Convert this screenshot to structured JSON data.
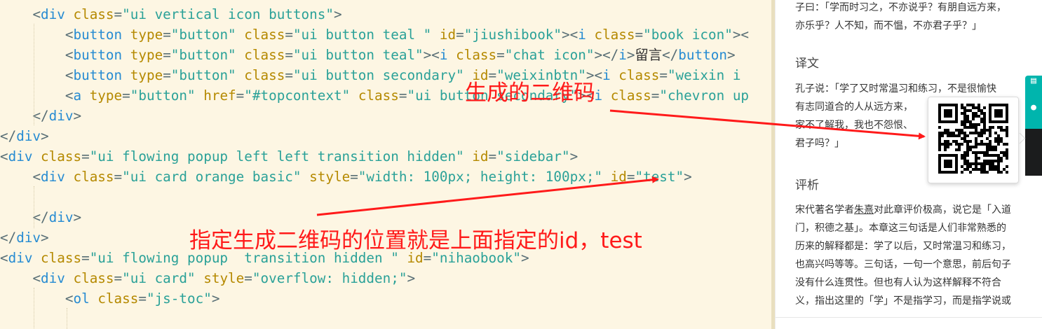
{
  "editor": {
    "lines": [
      {
        "indent": "    ",
        "tokens": [
          [
            "punc",
            "<"
          ],
          [
            "tag",
            "div"
          ],
          [
            "text",
            " "
          ],
          [
            "attr",
            "class"
          ],
          [
            "punc",
            "="
          ],
          [
            "val",
            "\"ui vertical icon buttons\""
          ],
          [
            "punc",
            ">"
          ]
        ]
      },
      {
        "indent": "        ",
        "tokens": [
          [
            "punc",
            "<"
          ],
          [
            "tag",
            "button"
          ],
          [
            "text",
            " "
          ],
          [
            "attr",
            "type"
          ],
          [
            "punc",
            "="
          ],
          [
            "val",
            "\"button\""
          ],
          [
            "text",
            " "
          ],
          [
            "attr",
            "class"
          ],
          [
            "punc",
            "="
          ],
          [
            "val",
            "\"ui button teal \""
          ],
          [
            "text",
            " "
          ],
          [
            "attr",
            "id"
          ],
          [
            "punc",
            "="
          ],
          [
            "val",
            "\"jiushibook\""
          ],
          [
            "punc",
            "><"
          ],
          [
            "tag",
            "i"
          ],
          [
            "text",
            " "
          ],
          [
            "attr",
            "class"
          ],
          [
            "punc",
            "="
          ],
          [
            "val",
            "\"book icon\""
          ],
          [
            "punc",
            "><"
          ]
        ]
      },
      {
        "indent": "        ",
        "tokens": [
          [
            "punc",
            "<"
          ],
          [
            "tag",
            "button"
          ],
          [
            "text",
            " "
          ],
          [
            "attr",
            "type"
          ],
          [
            "punc",
            "="
          ],
          [
            "val",
            "\"button\""
          ],
          [
            "text",
            " "
          ],
          [
            "attr",
            "class"
          ],
          [
            "punc",
            "="
          ],
          [
            "val",
            "\"ui button teal\""
          ],
          [
            "punc",
            "><"
          ],
          [
            "tag",
            "i"
          ],
          [
            "text",
            " "
          ],
          [
            "attr",
            "class"
          ],
          [
            "punc",
            "="
          ],
          [
            "val",
            "\"chat icon\""
          ],
          [
            "punc",
            "></"
          ],
          [
            "tag",
            "i"
          ],
          [
            "punc",
            ">"
          ],
          [
            "text",
            "留言"
          ],
          [
            "punc",
            "</"
          ],
          [
            "tag",
            "button"
          ],
          [
            "punc",
            ">"
          ]
        ]
      },
      {
        "indent": "        ",
        "tokens": [
          [
            "punc",
            "<"
          ],
          [
            "tag",
            "button"
          ],
          [
            "text",
            " "
          ],
          [
            "attr",
            "type"
          ],
          [
            "punc",
            "="
          ],
          [
            "val",
            "\"button\""
          ],
          [
            "text",
            " "
          ],
          [
            "attr",
            "class"
          ],
          [
            "punc",
            "="
          ],
          [
            "val",
            "\"ui button secondary\""
          ],
          [
            "text",
            " "
          ],
          [
            "attr",
            "id"
          ],
          [
            "punc",
            "="
          ],
          [
            "val",
            "\"weixinbtn\""
          ],
          [
            "punc",
            "><"
          ],
          [
            "tag",
            "i"
          ],
          [
            "text",
            " "
          ],
          [
            "attr",
            "class"
          ],
          [
            "punc",
            "="
          ],
          [
            "val",
            "\"weixin i"
          ]
        ]
      },
      {
        "indent": "        ",
        "tokens": [
          [
            "punc",
            "<"
          ],
          [
            "tag",
            "a"
          ],
          [
            "text",
            " "
          ],
          [
            "attr",
            "type"
          ],
          [
            "punc",
            "="
          ],
          [
            "val",
            "\"button\""
          ],
          [
            "text",
            " "
          ],
          [
            "attr",
            "href"
          ],
          [
            "punc",
            "="
          ],
          [
            "val",
            "\"#topcontext\""
          ],
          [
            "text",
            " "
          ],
          [
            "attr",
            "class"
          ],
          [
            "punc",
            "="
          ],
          [
            "val",
            "\"ui button secondary\""
          ],
          [
            "punc",
            "><"
          ],
          [
            "tag",
            "i"
          ],
          [
            "text",
            " "
          ],
          [
            "attr",
            "class"
          ],
          [
            "punc",
            "="
          ],
          [
            "val",
            "\"chevron up"
          ]
        ]
      },
      {
        "indent": "    ",
        "tokens": [
          [
            "punc",
            "</"
          ],
          [
            "tag",
            "div"
          ],
          [
            "punc",
            ">"
          ]
        ]
      },
      {
        "indent": "",
        "tokens": [
          [
            "punc",
            "</"
          ],
          [
            "tag",
            "div"
          ],
          [
            "punc",
            ">"
          ]
        ]
      },
      {
        "indent": "",
        "tokens": [
          [
            "punc",
            "<"
          ],
          [
            "tag",
            "div"
          ],
          [
            "text",
            " "
          ],
          [
            "attr",
            "class"
          ],
          [
            "punc",
            "="
          ],
          [
            "val",
            "\"ui flowing popup left left transition hidden\""
          ],
          [
            "text",
            " "
          ],
          [
            "attr",
            "id"
          ],
          [
            "punc",
            "="
          ],
          [
            "val",
            "\"sidebar\""
          ],
          [
            "punc",
            ">"
          ]
        ]
      },
      {
        "indent": "    ",
        "tokens": [
          [
            "punc",
            "<"
          ],
          [
            "tag",
            "div"
          ],
          [
            "text",
            " "
          ],
          [
            "attr",
            "class"
          ],
          [
            "punc",
            "="
          ],
          [
            "val",
            "\"ui card orange basic\""
          ],
          [
            "text",
            " "
          ],
          [
            "attr",
            "style"
          ],
          [
            "punc",
            "="
          ],
          [
            "val",
            "\"width: 100px; height: 100px;\""
          ],
          [
            "text",
            " "
          ],
          [
            "attr",
            "id"
          ],
          [
            "punc",
            "="
          ],
          [
            "val",
            "\"test\""
          ],
          [
            "punc",
            ">"
          ]
        ]
      },
      {
        "indent": "",
        "tokens": []
      },
      {
        "indent": "    ",
        "tokens": [
          [
            "punc",
            "</"
          ],
          [
            "tag",
            "div"
          ],
          [
            "punc",
            ">"
          ]
        ]
      },
      {
        "indent": "",
        "tokens": [
          [
            "punc",
            "</"
          ],
          [
            "tag",
            "div"
          ],
          [
            "punc",
            ">"
          ]
        ]
      },
      {
        "indent": "",
        "tokens": [
          [
            "punc",
            "<"
          ],
          [
            "tag",
            "div"
          ],
          [
            "text",
            " "
          ],
          [
            "attr",
            "class"
          ],
          [
            "punc",
            "="
          ],
          [
            "val",
            "\"ui flowing popup  transition hidden \""
          ],
          [
            "text",
            " "
          ],
          [
            "attr",
            "id"
          ],
          [
            "punc",
            "="
          ],
          [
            "val",
            "\"nihaobook\""
          ],
          [
            "punc",
            ">"
          ]
        ]
      },
      {
        "indent": "    ",
        "tokens": [
          [
            "punc",
            "<"
          ],
          [
            "tag",
            "div"
          ],
          [
            "text",
            " "
          ],
          [
            "attr",
            "class"
          ],
          [
            "punc",
            "="
          ],
          [
            "val",
            "\"ui card\""
          ],
          [
            "text",
            " "
          ],
          [
            "attr",
            "style"
          ],
          [
            "punc",
            "="
          ],
          [
            "val",
            "\"overflow: hidden;\""
          ],
          [
            "punc",
            ">"
          ]
        ]
      },
      {
        "indent": "        ",
        "tokens": [
          [
            "punc",
            "<"
          ],
          [
            "tag",
            "ol"
          ],
          [
            "text",
            " "
          ],
          [
            "attr",
            "class"
          ],
          [
            "punc",
            "="
          ],
          [
            "val",
            "\"js-toc\""
          ],
          [
            "punc",
            ">"
          ]
        ]
      },
      {
        "indent": "",
        "tokens": []
      }
    ]
  },
  "reader": {
    "quote_lines": [
      "子曰：「学而时习之，不亦说乎？有朋自远方来，",
      "亦乐乎？人不知，而不愠，不亦君子乎？」"
    ],
    "translation_heading": "译文",
    "translation_lines": [
      "孔子说：「学了又时常温习和练习，不是很愉快",
      "有志同道合的人从远方来，",
      "家不了解我，我也不怨恨、",
      "君子吗？」"
    ],
    "commentary_heading": "评析",
    "commentary_line1_pre": "宋代著名学者",
    "commentary_line1_link": "朱熹",
    "commentary_line1_post": "对此章评价极高，说它是「入道",
    "commentary_lines": [
      "门，积德之基」。本章这三句话是人们非常熟悉的",
      "历来的解释都是：学了以后，又时常温习和练习，",
      "也高兴吗等等。三句话，一句一个意思，前后句子",
      "没有什么连贯性。但也有人认为这样解释不符合",
      "义，指出这里的「学」不是指学习，而是指学说或"
    ]
  },
  "annotations": {
    "qr_label": "生成的二维码",
    "position_label": "指定生成二维码的位置就是上面指定的id，test",
    "color": "#ff1a1a"
  },
  "popup": {
    "icon": "qr-code-icon"
  },
  "sidebar_buttons": {
    "colors": {
      "teal": "#00b5ad",
      "dark": "#1b1c1d"
    }
  }
}
